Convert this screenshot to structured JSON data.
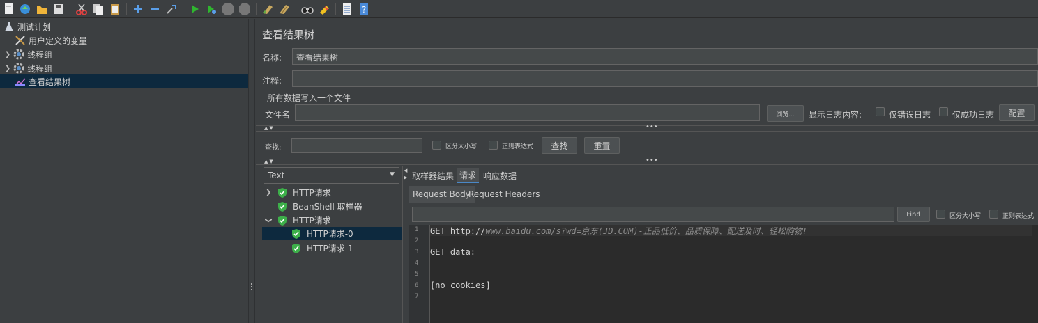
{
  "toolbar": {
    "icons": [
      "template-icon",
      "open-icon",
      "folder-icon",
      "save-icon",
      "cut-icon",
      "copy-icon",
      "paste-icon",
      "add-icon",
      "remove-icon",
      "toggle-icon",
      "start-icon",
      "start-no-pause-icon",
      "stop-icon",
      "shutdown-icon",
      "clear-icon",
      "clear-all-icon",
      "search-icon",
      "reset-search-icon",
      "function-helper-icon",
      "help-icon"
    ]
  },
  "tree": {
    "items": [
      {
        "label": "测试计划",
        "icon": "flask-icon",
        "expandable": false
      },
      {
        "label": "用户定义的变量",
        "icon": "wrench-icon",
        "expandable": false
      },
      {
        "label": "线程组",
        "icon": "gear-icon",
        "expandable": true
      },
      {
        "label": "线程组",
        "icon": "gear-icon",
        "expandable": true
      },
      {
        "label": "查看结果树",
        "icon": "chart-icon",
        "expandable": false,
        "selected": true
      }
    ]
  },
  "panel": {
    "title": "查看结果树",
    "name_label": "名称:",
    "name_value": "查看结果树",
    "comment_label": "注释:",
    "comment_value": "",
    "file_group_label": "所有数据写入一个文件",
    "filename_label": "文件名",
    "filename_value": "",
    "browse_label": "浏览...",
    "log_display_label": "显示日志内容:",
    "errors_only_label": "仅错误日志",
    "success_only_label": "仅成功日志",
    "configure_label": "配置"
  },
  "search": {
    "label": "查找:",
    "value": "",
    "case_sensitive_label": "区分大小写",
    "regex_label": "正则表达式",
    "find_label": "查找",
    "reset_label": "重置"
  },
  "results": {
    "renderer": "Text",
    "items": [
      {
        "label": "HTTP请求",
        "expandable": true,
        "expanded": false,
        "level": 0
      },
      {
        "label": "BeanShell 取样器",
        "expandable": false,
        "level": 0
      },
      {
        "label": "HTTP请求",
        "expandable": true,
        "expanded": true,
        "level": 0
      },
      {
        "label": "HTTP请求-0",
        "expandable": false,
        "level": 1,
        "selected": true
      },
      {
        "label": "HTTP请求-1",
        "expandable": false,
        "level": 1
      }
    ]
  },
  "tabs": {
    "items": [
      {
        "label": "取样器结果",
        "active": false
      },
      {
        "label": "请求",
        "active": true
      },
      {
        "label": "响应数据",
        "active": false
      }
    ],
    "subtabs": [
      {
        "label": "Request Body",
        "active": true
      },
      {
        "label": "Request Headers",
        "active": false
      }
    ]
  },
  "body_search": {
    "value": "",
    "find_label": "Find",
    "case_sensitive_label": "区分大小写",
    "regex_label": "正则表达式"
  },
  "code": {
    "line_numbers": [
      "1",
      "2",
      "3",
      "4",
      "5",
      "6",
      "7"
    ],
    "line1_prefix": "GET http://",
    "line1_url": "www.baidu.com/s?wd",
    "line1_suffix": "=京东(JD.COM)-正品低价、品质保障、配送及时、轻松购物!",
    "line3": "GET data:",
    "line6": "[no cookies]"
  },
  "colors": {
    "background": "#3c3f41",
    "selection": "#0d293e",
    "shield_green": "#3db04a",
    "run_green": "#2fb52f"
  }
}
